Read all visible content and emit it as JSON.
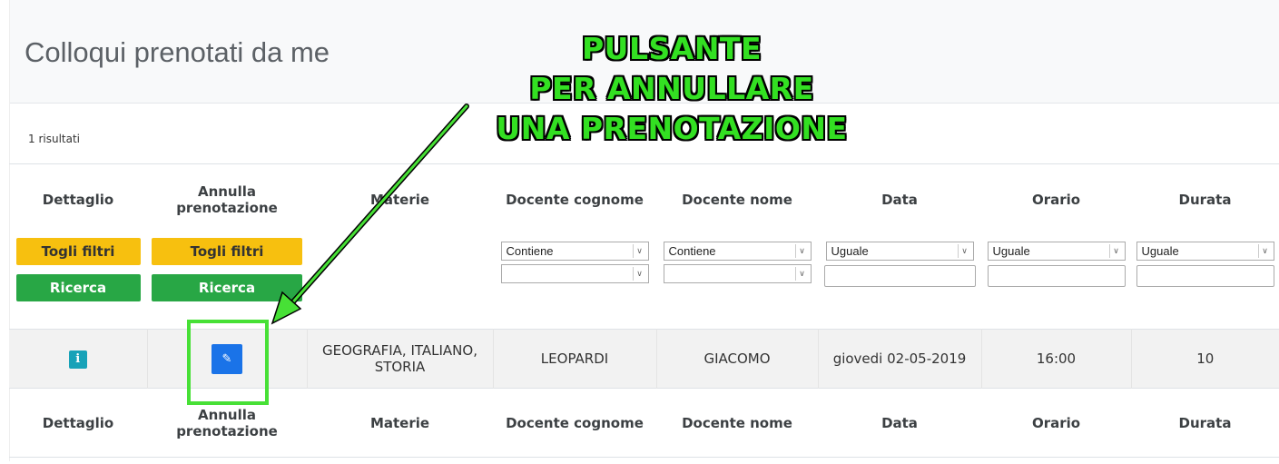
{
  "page": {
    "title": "Colloqui prenotati da me",
    "results_count": "1 risultati"
  },
  "annotation": {
    "lines": [
      "PULSANTE",
      "PER ANNULLARE",
      "UNA PRENOTAZIONE"
    ],
    "color": "#33e022"
  },
  "columns": [
    "Dettaglio",
    "Annulla prenotazione",
    "Materie",
    "Docente cognome",
    "Docente nome",
    "Data",
    "Orario",
    "Durata"
  ],
  "filters": {
    "clear_label": "Togli filtri",
    "search_label": "Ricerca",
    "docente_cognome": {
      "operator": "Contiene",
      "value": ""
    },
    "docente_nome": {
      "operator": "Contiene",
      "value": ""
    },
    "data": {
      "operator": "Uguale",
      "value": ""
    },
    "orario": {
      "operator": "Uguale",
      "value": ""
    },
    "durata": {
      "operator": "Uguale",
      "value": ""
    }
  },
  "rows": [
    {
      "detail_icon": "info-icon",
      "cancel_icon": "edit-icon",
      "materie": "GEOGRAFIA, ITALIANO, STORIA",
      "docente_cognome": "LEOPARDI",
      "docente_nome": "GIACOMO",
      "data": "giovedi 02-05-2019",
      "orario": "16:00",
      "durata": "10"
    }
  ],
  "colors": {
    "clear_button": "#f7c00f",
    "search_button": "#28a745",
    "info_button": "#17a2b8",
    "cancel_button": "#1a73e8",
    "highlight": "#47e036"
  }
}
